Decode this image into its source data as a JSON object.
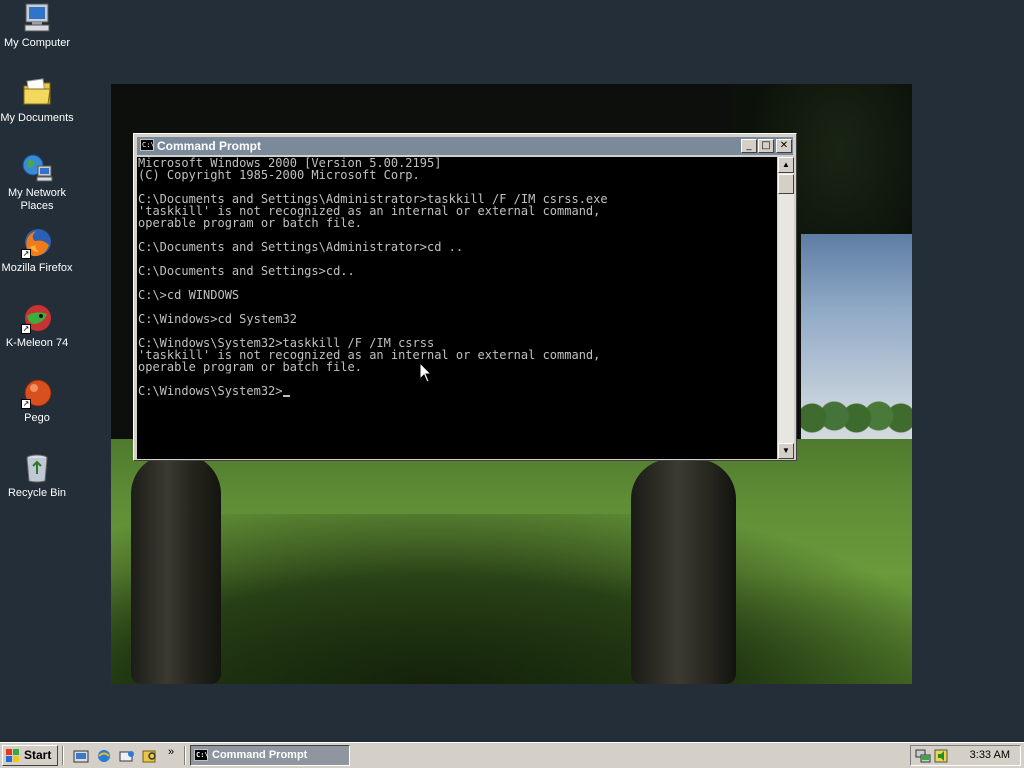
{
  "desktop": {
    "icons": [
      {
        "label": "My Computer"
      },
      {
        "label": "My Documents"
      },
      {
        "label": "My Network Places"
      },
      {
        "label": "Mozilla Firefox"
      },
      {
        "label": "K-Meleon 74"
      },
      {
        "label": "Pego"
      },
      {
        "label": "Recycle Bin"
      }
    ]
  },
  "window": {
    "title": "Command Prompt",
    "icon_text": "C:\\",
    "minimize_glyph": "_",
    "maximize_glyph": "□",
    "close_glyph": "✕",
    "console_lines": [
      "Microsoft Windows 2000 [Version 5.00.2195]",
      "(C) Copyright 1985-2000 Microsoft Corp.",
      "",
      "C:\\Documents and Settings\\Administrator>taskkill /F /IM csrss.exe",
      "'taskkill' is not recognized as an internal or external command,",
      "operable program or batch file.",
      "",
      "C:\\Documents and Settings\\Administrator>cd ..",
      "",
      "C:\\Documents and Settings>cd..",
      "",
      "C:\\>cd WINDOWS",
      "",
      "C:\\Windows>cd System32",
      "",
      "C:\\Windows\\System32>taskkill /F /IM csrss",
      "'taskkill' is not recognized as an internal or external command,",
      "operable program or batch file.",
      "",
      "C:\\Windows\\System32>"
    ],
    "scroll_up_glyph": "▲",
    "scroll_down_glyph": "▼"
  },
  "taskbar": {
    "start_label": "Start",
    "quick_launch_more": "»",
    "task_button_label": "Command Prompt",
    "clock": "3:33 AM"
  },
  "colors": {
    "desktop_bg": "#232e38",
    "console_bg": "#000000",
    "console_fg": "#c0c0c0",
    "titlebar_inactive": "#7a8a9a",
    "chrome": "#d4d0c8"
  },
  "icons": {
    "my_computer": "computer-icon",
    "my_documents": "folder-icon",
    "network": "network-icon",
    "firefox": "firefox-icon",
    "kmeleon": "k-meleon-icon",
    "pego": "pego-icon",
    "recycle_bin": "recycle-bin-icon"
  }
}
